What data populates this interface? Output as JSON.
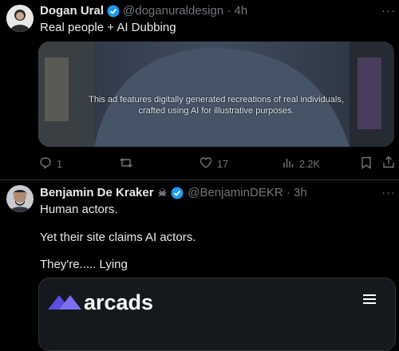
{
  "post1": {
    "author_name": "Dogan Ural",
    "handle_time": "@doganuraldesign · 4h",
    "text": "Real people + AI Dubbing",
    "media_caption_line1": "This ad features digitally generated recreations of real individuals,",
    "media_caption_line2": "crafted using AI for illustrative purposes.",
    "actions": {
      "replies": "1",
      "retweets": "",
      "likes": "17",
      "views": "2.2K"
    },
    "icons": [
      "reply-icon",
      "retweet-icon",
      "like-icon",
      "views-icon",
      "bookmark-icon",
      "share-icon"
    ]
  },
  "post2": {
    "author_name": "Benjamin De Kraker",
    "name_emoji": "☠",
    "handle_time": "@BenjaminDEKR · 3h",
    "lines": [
      "Human actors.",
      "Yet their site claims AI actors.",
      "They're..... Lying"
    ],
    "card": {
      "brand": "arcads"
    }
  },
  "colors": {
    "background": "#000000",
    "text": "#e7e9ea",
    "muted": "#71767b",
    "verified": "#1d9bf0",
    "logo_purple": "#5b4fe0"
  }
}
